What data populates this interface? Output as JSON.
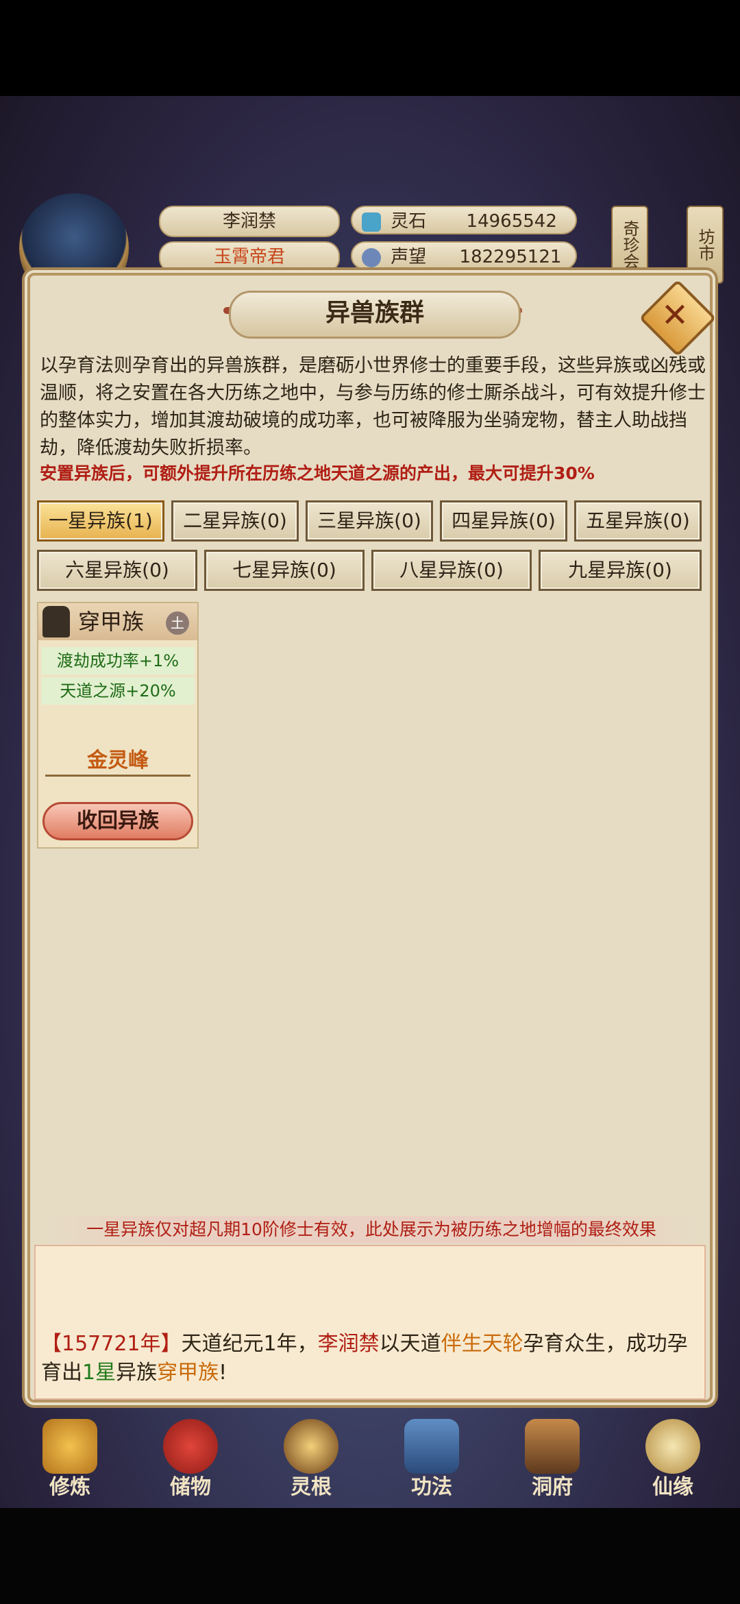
{
  "header": {
    "player_name": "李润禁",
    "player_title": "玉霄帝君",
    "stone_label": "灵石",
    "stone_value": "14965542",
    "fame_label": "声望",
    "fame_value": "182295121",
    "side_tabs": [
      "奇珍会",
      "坊市"
    ]
  },
  "modal": {
    "title": "异兽族群",
    "description": "以孕育法则孕育出的异兽族群，是磨砺小世界修士的重要手段，这些异族或凶残或温顺，将之安置在各大历练之地中，与参与历练的修士厮杀战斗，可有效提升修士的整体实力，增加其渡劫破境的成功率，也可被降服为坐骑宠物，替主人助战挡劫，降低渡劫失败折损率。",
    "highlight": "安置异族后，可额外提升所在历练之地天道之源的产出，最大可提升30%",
    "tabs": [
      "一星异族(1)",
      "二星异族(0)",
      "三星异族(0)",
      "四星异族(0)",
      "五星异族(0)",
      "六星异族(0)",
      "七星异族(0)",
      "八星异族(0)",
      "九星异族(0)"
    ],
    "active_tab": "一星异族(1)",
    "card": {
      "name": "穿甲族",
      "badge": "土",
      "stat1": "渡劫成功率+1%",
      "stat2": "天道之源+20%",
      "location": "金灵峰",
      "button": "收回异族"
    },
    "footer_note": "一星异族仅对超凡期10阶修士有效，此处展示为被历练之地增幅的最终效果",
    "log": {
      "year": "【157721年】",
      "p1": "天道纪元1年，",
      "name": "李润禁",
      "p2": "以天道",
      "item": "伴生天轮",
      "p3": "孕育众生，成功孕育出",
      "star": "1星",
      "p4": "异族",
      "race": "穿甲族",
      "p5": "!"
    }
  },
  "nav": [
    "修炼",
    "储物",
    "灵根",
    "功法",
    "洞府",
    "仙缘"
  ],
  "colors": {
    "accent_red": "#b01e14",
    "accent_orange": "#c96a0a",
    "accent_green": "#1f7a1a",
    "active_tab": "#e7b24f"
  }
}
